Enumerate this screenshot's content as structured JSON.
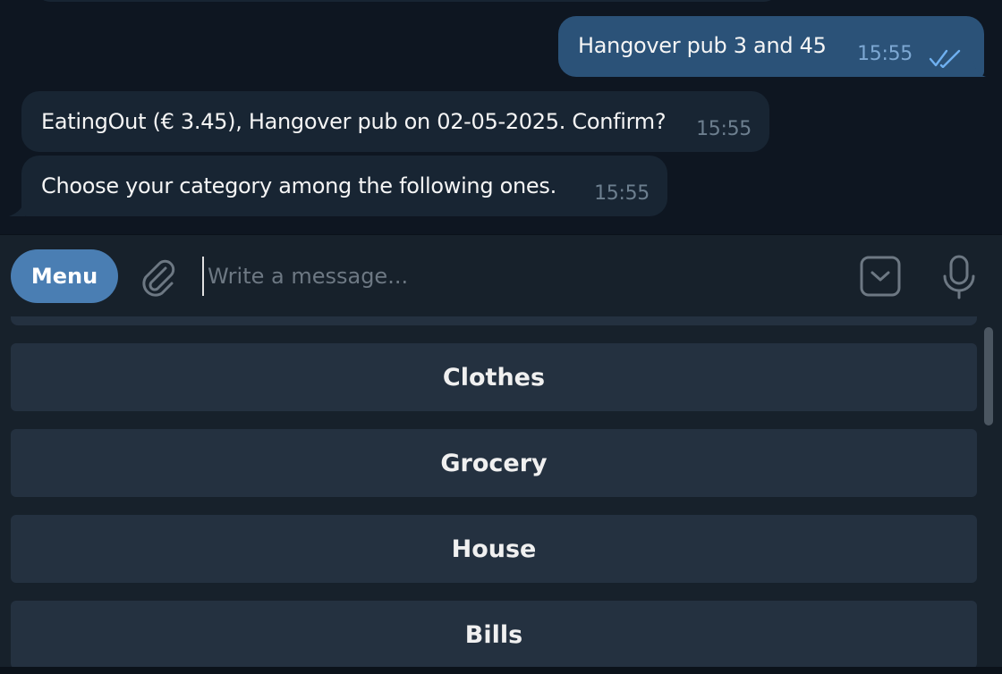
{
  "messages": [
    {
      "direction": "outgoing",
      "text": "Hangover pub 3 and 45",
      "time": "15:55",
      "status_icon": "double-check-icon"
    },
    {
      "direction": "incoming",
      "text": "EatingOut (€ 3.45), Hangover pub on 02-05-2025. Confirm?",
      "time": "15:55"
    },
    {
      "direction": "incoming",
      "text": "Choose your category among the following ones.",
      "time": "15:55"
    }
  ],
  "composer": {
    "menu_label": "Menu",
    "placeholder": "Write a message...",
    "icons": [
      "paperclip-icon",
      "keyboard-toggle-icon",
      "microphone-icon"
    ]
  },
  "keyboard": {
    "buttons": [
      "Clothes",
      "Grocery",
      "House",
      "Bills"
    ]
  },
  "colors": {
    "background": "#0e1621",
    "incoming_bubble": "#182533",
    "outgoing_bubble": "#2b5278",
    "panel": "#17212b",
    "accent": "#4a7eb3",
    "keyboard_button": "#243140"
  }
}
